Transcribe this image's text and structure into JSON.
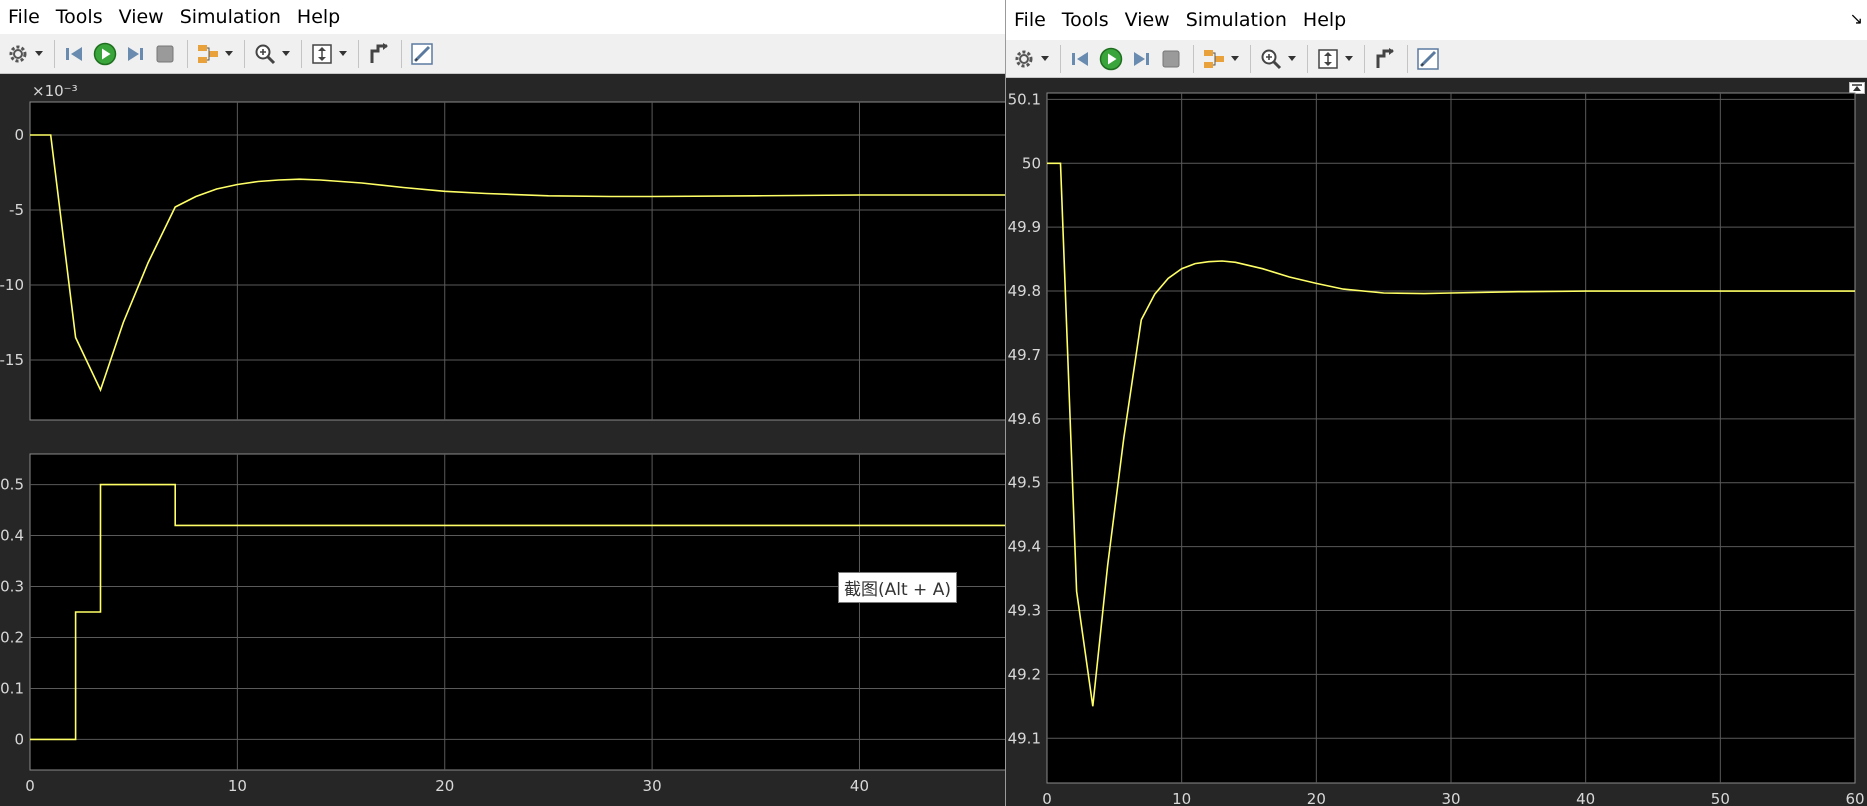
{
  "left_window": {
    "menu": [
      "File",
      "Tools",
      "View",
      "Simulation",
      "Help"
    ],
    "toolbar_icons": [
      "gear-icon",
      "step-back-icon",
      "run-icon",
      "step-forward-icon",
      "stop-icon",
      "signal-tools-icon",
      "zoom-icon",
      "autoscale-icon",
      "highlight-block-icon",
      "style-icon"
    ],
    "tooltip": "截图(Alt + A)"
  },
  "right_window": {
    "menu": [
      "File",
      "Tools",
      "View",
      "Simulation",
      "Help"
    ],
    "toolbar_icons": [
      "gear-icon",
      "step-back-icon",
      "run-icon",
      "step-forward-icon",
      "stop-icon",
      "signal-tools-icon",
      "zoom-icon",
      "autoscale-icon",
      "highlight-block-icon",
      "style-icon"
    ],
    "corner_icon": "↘"
  },
  "colors": {
    "plot_bg": "#000000",
    "figure_bg": "#262626",
    "grid": "#5a5a5a",
    "line": "#ffff66",
    "ticks": "#d8d8d8"
  },
  "chart_data": [
    {
      "type": "line",
      "title": "",
      "xlabel": "",
      "ylabel": "",
      "exponent_label": "×10⁻³",
      "xlim": [
        0,
        47.5
      ],
      "ylim": [
        -19,
        2.2
      ],
      "xticks": [
        0,
        10,
        20,
        30,
        40
      ],
      "yticks": [
        0,
        -5,
        -10,
        -15
      ],
      "grid": true,
      "series": [
        {
          "x": [
            0,
            1,
            2.2,
            3.4,
            4.5,
            5.7,
            7,
            8,
            9,
            10,
            11,
            12,
            13,
            14,
            16,
            18,
            20,
            22,
            25,
            28,
            30,
            35,
            40,
            45,
            47.5
          ],
          "y": [
            0,
            0,
            -13.5,
            -17,
            -12.5,
            -8.5,
            -4.8,
            -4.1,
            -3.6,
            -3.3,
            -3.1,
            -3.0,
            -2.95,
            -3.0,
            -3.2,
            -3.5,
            -3.75,
            -3.9,
            -4.05,
            -4.1,
            -4.1,
            -4.05,
            -4.0,
            -4.0,
            -4.0
          ]
        }
      ]
    },
    {
      "type": "line",
      "title": "",
      "xlabel": "",
      "ylabel": "",
      "xlim": [
        0,
        47.5
      ],
      "ylim": [
        -0.06,
        0.56
      ],
      "xticks": [
        0,
        10,
        20,
        30,
        40
      ],
      "yticks": [
        0,
        0.1,
        0.2,
        0.3,
        0.4,
        0.5
      ],
      "grid": true,
      "series": [
        {
          "x": [
            0,
            2.2,
            2.2,
            3.4,
            3.4,
            7,
            7,
            47.5
          ],
          "y": [
            0,
            0,
            0.25,
            0.25,
            0.5,
            0.5,
            0.42,
            0.42
          ]
        }
      ]
    },
    {
      "type": "line",
      "title": "",
      "xlabel": "",
      "ylabel": "",
      "xlim": [
        0,
        60
      ],
      "ylim": [
        49.03,
        50.11
      ],
      "xticks": [
        0,
        10,
        20,
        30,
        40,
        50,
        60
      ],
      "yticks": [
        49.1,
        49.2,
        49.3,
        49.4,
        49.5,
        49.6,
        49.7,
        49.8,
        49.9,
        50,
        50.1
      ],
      "grid": true,
      "series": [
        {
          "x": [
            0,
            1,
            2.2,
            3.4,
            4.5,
            5.7,
            7,
            8,
            9,
            10,
            11,
            12,
            13,
            14,
            16,
            18,
            20,
            22,
            25,
            28,
            30,
            35,
            40,
            50,
            60
          ],
          "y": [
            50,
            50,
            49.33,
            49.15,
            49.37,
            49.57,
            49.755,
            49.795,
            49.82,
            49.835,
            49.843,
            49.846,
            49.847,
            49.845,
            49.835,
            49.822,
            49.812,
            49.803,
            49.797,
            49.796,
            49.797,
            49.799,
            49.8,
            49.8,
            49.8
          ]
        }
      ]
    }
  ]
}
